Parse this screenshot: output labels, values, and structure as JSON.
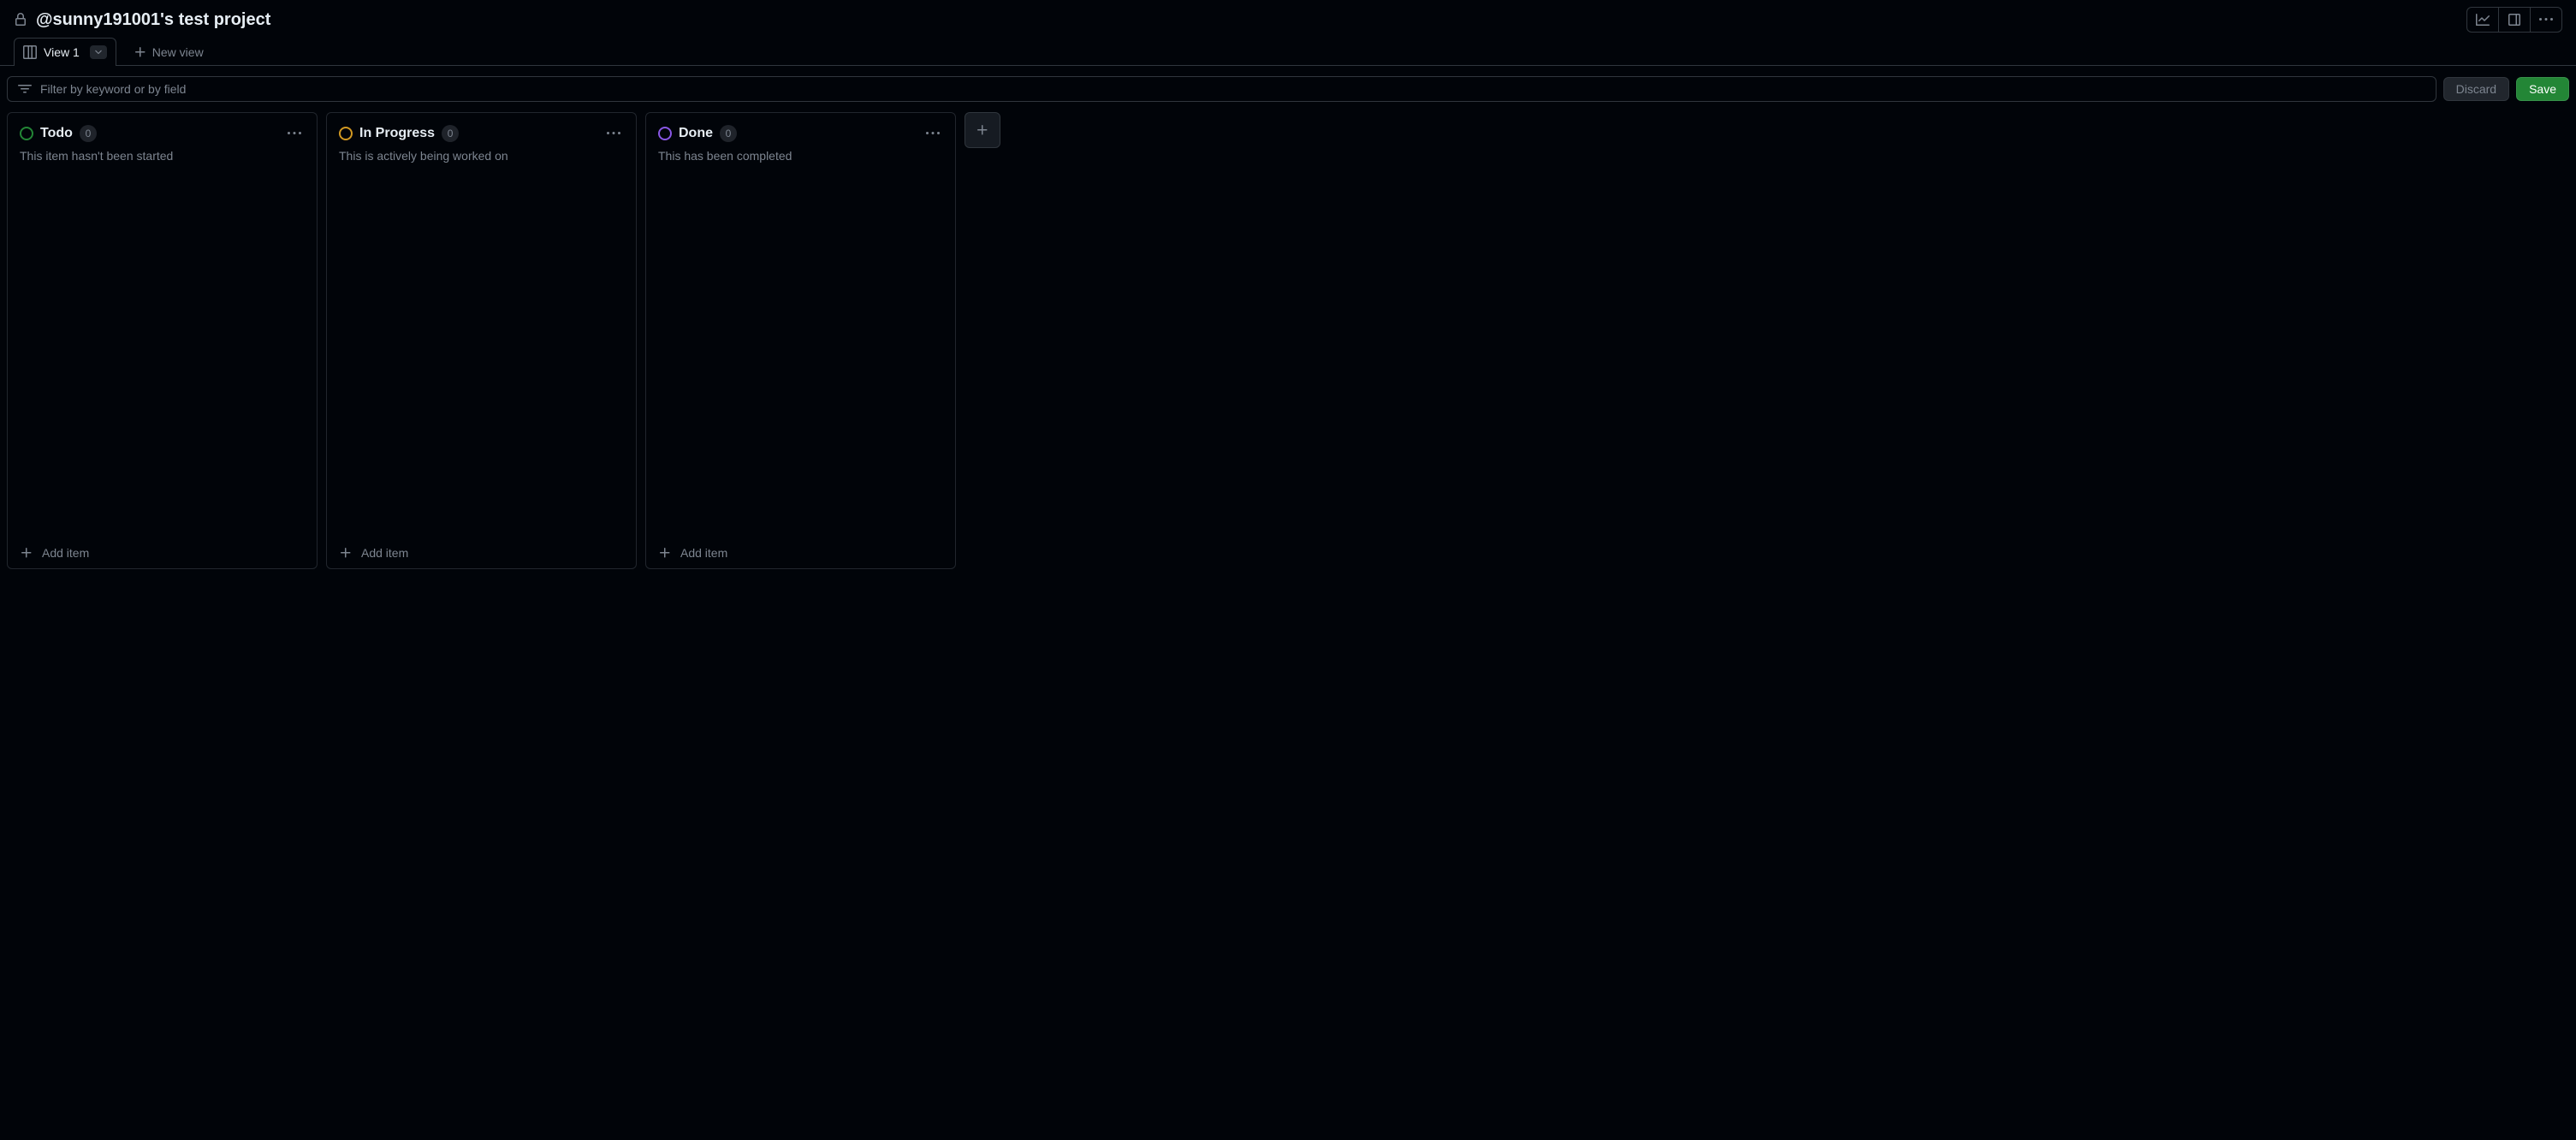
{
  "header": {
    "title": "@sunny191001's test project"
  },
  "tabs": {
    "active": "View 1",
    "new_view_label": "New view"
  },
  "filter": {
    "placeholder": "Filter by keyword or by field",
    "discard_label": "Discard",
    "save_label": "Save"
  },
  "columns": [
    {
      "title": "Todo",
      "count": "0",
      "description": "This item hasn't been started",
      "status_color": "green",
      "add_item_label": "Add item"
    },
    {
      "title": "In Progress",
      "count": "0",
      "description": "This is actively being worked on",
      "status_color": "yellow",
      "add_item_label": "Add item"
    },
    {
      "title": "Done",
      "count": "0",
      "description": "This has been completed",
      "status_color": "purple",
      "add_item_label": "Add item"
    }
  ]
}
